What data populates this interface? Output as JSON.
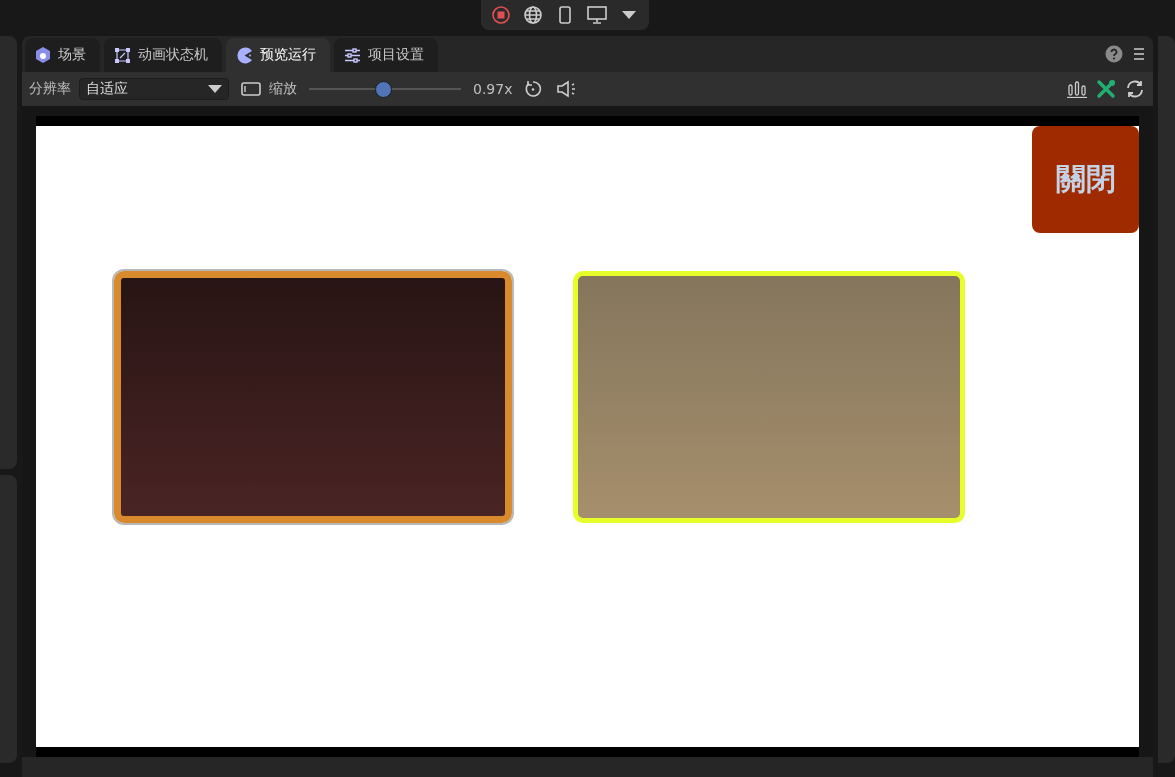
{
  "top_toolbar": {
    "buttons": [
      {
        "kind": "record"
      },
      {
        "kind": "globe"
      },
      {
        "kind": "phone"
      },
      {
        "kind": "monitor"
      },
      {
        "kind": "caret"
      }
    ]
  },
  "tabs": [
    {
      "label": "场景",
      "kind": "scene",
      "selected": false
    },
    {
      "label": "动画状态机",
      "kind": "graph",
      "selected": false
    },
    {
      "label": "预览运行",
      "kind": "preview",
      "selected": true
    },
    {
      "label": "项目设置",
      "kind": "settings",
      "selected": false
    }
  ],
  "toolbar": {
    "resolution_label": "分辨率",
    "resolution_value": "自适应",
    "zoom_label": "缩放",
    "zoom": {
      "level": 0.49
    },
    "zoom_reading": "0.97x"
  },
  "preview": {
    "close_button": "關閉",
    "cards": [
      {
        "kind": "dark"
      },
      {
        "kind": "glow"
      }
    ]
  }
}
